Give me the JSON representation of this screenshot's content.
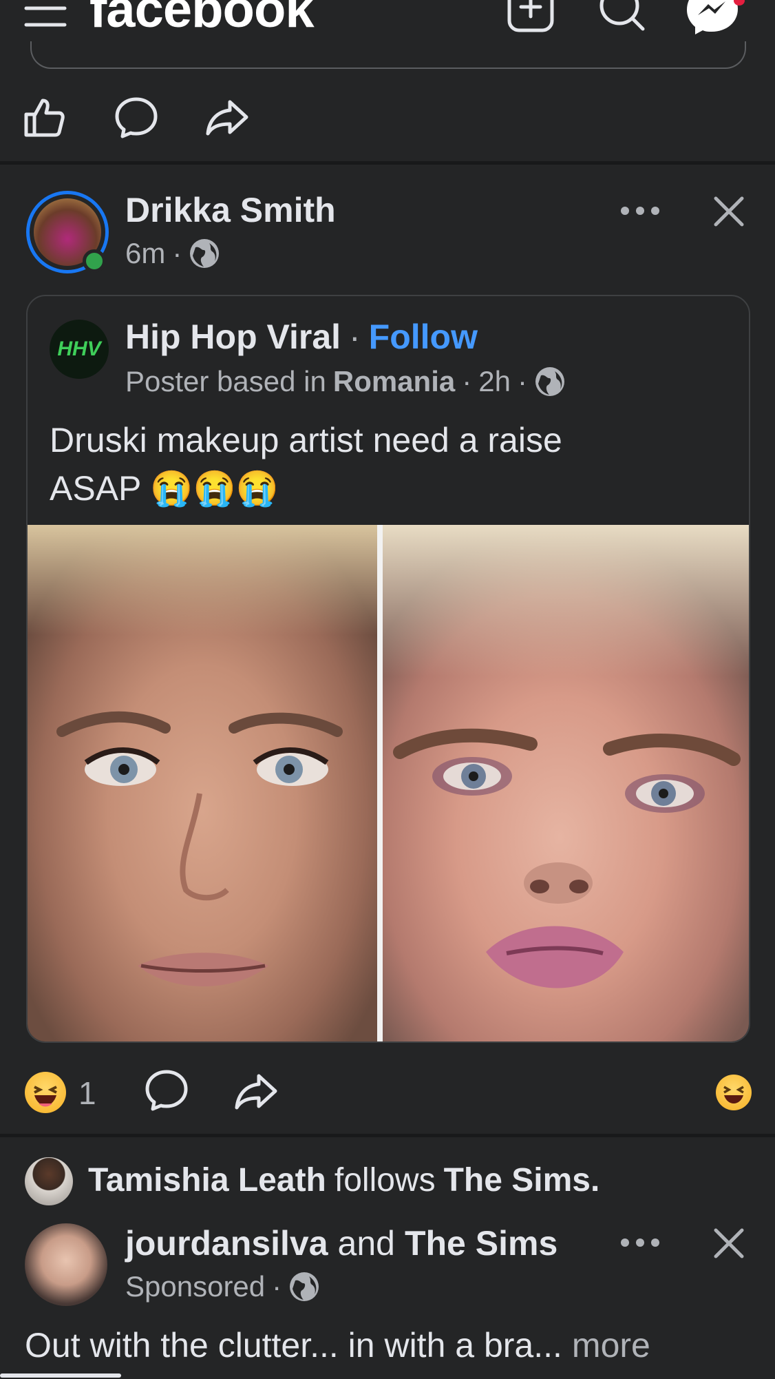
{
  "header": {
    "logo": "facebook",
    "icons": [
      "menu-icon",
      "create-icon",
      "search-icon",
      "messenger-icon"
    ]
  },
  "post": {
    "author": "Drikka Smith",
    "time": "6m",
    "separator": "·",
    "shared": {
      "page_name": "Hip Hop Viral",
      "avatar_text": "HHV",
      "follow_label": "Follow",
      "poster_prefix": "Poster based in",
      "poster_location": "Romania",
      "time": "2h",
      "text_line1": "Druski makeup artist need a raise",
      "text_line2": "ASAP 😭😭😭"
    },
    "reaction_count": "1",
    "reaction_emoji": "😆"
  },
  "suggested": {
    "follower_name": "Tamishia Leath",
    "follows_word": "follows",
    "followed_page": "The Sims."
  },
  "ad": {
    "name1": "jourdansilva",
    "and_word": "and",
    "name2": "The Sims",
    "sponsored": "Sponsored",
    "text": "Out with the clutter... in with a bra...",
    "more": "more"
  },
  "colors": {
    "background": "#242526",
    "accent": "#4599ff",
    "online": "#31a24c"
  }
}
